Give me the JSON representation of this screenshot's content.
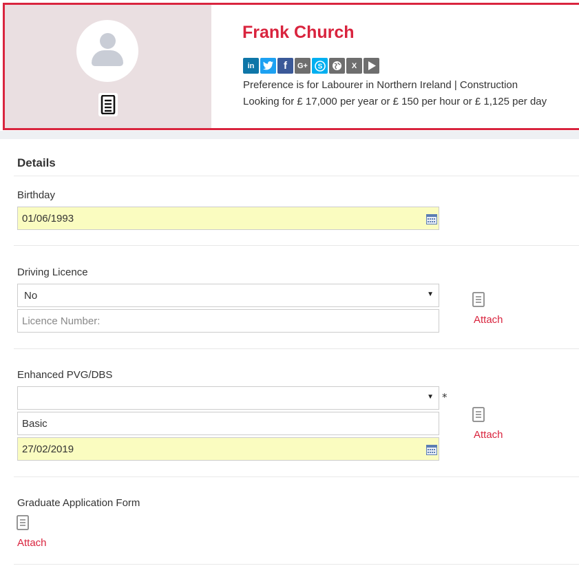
{
  "profile": {
    "name": "Frank Church",
    "preference": "Preference is for Labourer in Northern Ireland | Construction",
    "looking_for": "Looking for £ 17,000 per year or £ 150 per hour or £ 1,125 per day",
    "avatar_icon": "user-silhouette-icon",
    "cv_icon": "document-icon",
    "socials": [
      {
        "name": "linkedin-icon",
        "glyph": "in",
        "color": "#0e76a8"
      },
      {
        "name": "twitter-icon",
        "glyph": "",
        "color": "#1da1f2"
      },
      {
        "name": "facebook-icon",
        "glyph": "f",
        "color": "#3b5998"
      },
      {
        "name": "google-plus-icon",
        "glyph": "G+",
        "color": "#6e6e6e"
      },
      {
        "name": "skype-icon",
        "glyph": "S",
        "color": "#00aff0"
      },
      {
        "name": "website-icon",
        "glyph": "",
        "color": "#6e6e6e"
      },
      {
        "name": "xing-icon",
        "glyph": "X",
        "color": "#6e6e6e"
      },
      {
        "name": "youtube-icon",
        "glyph": "",
        "color": "#6e6e6e"
      }
    ]
  },
  "details": {
    "title": "Details",
    "birthday": {
      "label": "Birthday",
      "value": "01/06/1993"
    },
    "driving_licence": {
      "label": "Driving Licence",
      "selected": "No",
      "licence_placeholder": "Licence Number:",
      "attach_label": "Attach"
    },
    "pvg": {
      "label": "Enhanced PVG/DBS",
      "selected": "",
      "required_marker": "*",
      "level": "Basic",
      "date": "27/02/2019",
      "attach_label": "Attach"
    },
    "graduate_form": {
      "label": "Graduate Application Form",
      "attach_label": "Attach"
    }
  },
  "colors": {
    "accent": "#d9243e",
    "date_field": "#fafcc0",
    "avatar_panel": "#eadfe1"
  }
}
